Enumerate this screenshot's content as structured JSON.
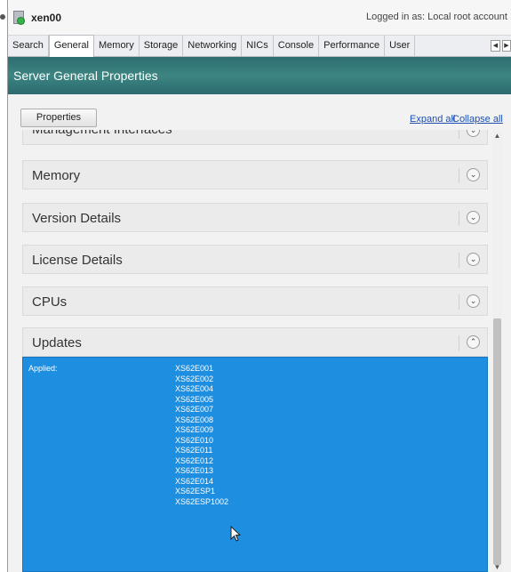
{
  "window": {
    "host_name": "xen00",
    "logged_in": "Logged in as:  Local root account"
  },
  "tabs": [
    {
      "label": "Search",
      "active": false
    },
    {
      "label": "General",
      "active": true
    },
    {
      "label": "Memory",
      "active": false
    },
    {
      "label": "Storage",
      "active": false
    },
    {
      "label": "Networking",
      "active": false
    },
    {
      "label": "NICs",
      "active": false
    },
    {
      "label": "Console",
      "active": false
    },
    {
      "label": "Performance",
      "active": false
    },
    {
      "label": "User",
      "active": false
    }
  ],
  "header": {
    "title": "Server General Properties"
  },
  "toolbar": {
    "properties_label": "Properties",
    "expand_all_label": "Expand all",
    "collapse_all_label": "Collapse all"
  },
  "sections": [
    {
      "label": "Management Interfaces",
      "expanded": false
    },
    {
      "label": "Memory",
      "expanded": false
    },
    {
      "label": "Version Details",
      "expanded": false
    },
    {
      "label": "License Details",
      "expanded": false
    },
    {
      "label": "CPUs",
      "expanded": false
    },
    {
      "label": "Updates",
      "expanded": true
    }
  ],
  "updates": {
    "applied_label": "Applied:",
    "items": [
      "XS62E001",
      "XS62E002",
      "XS62E004",
      "XS62E005",
      "XS62E007",
      "XS62E008",
      "XS62E009",
      "XS62E010",
      "XS62E011",
      "XS62E012",
      "XS62E013",
      "XS62E014",
      "XS62ESP1",
      "XS62ESP1002"
    ]
  },
  "colors": {
    "header_band": "#3c8582",
    "selection": "#1e8ee0",
    "link": "#1d4fb0"
  }
}
